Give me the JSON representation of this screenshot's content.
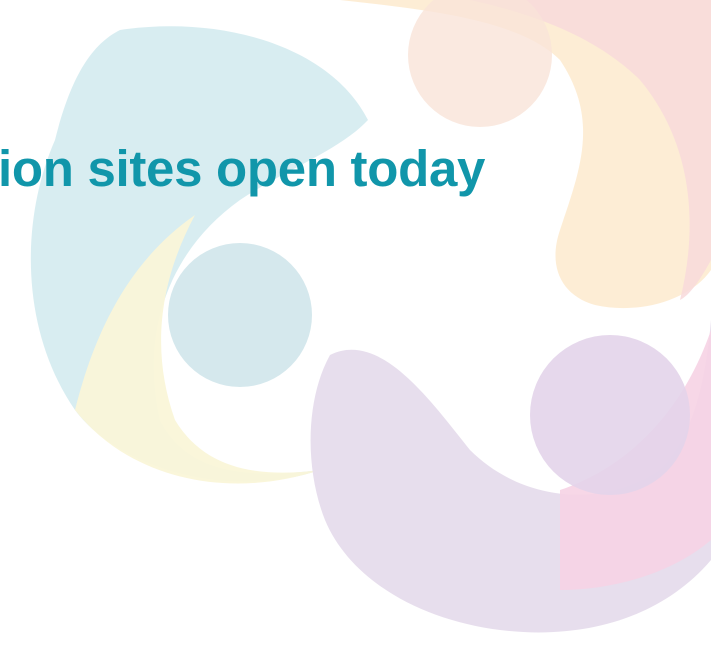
{
  "slide": {
    "headline": "ion sites open today"
  },
  "colors": {
    "background": "#ffffff",
    "headline": "#1196AA",
    "blue_petal": "#D6ECF0",
    "yellow_petal": "#FAF6D8",
    "peach_petal": "#FDEBD0",
    "pink_petal": "#F8D9DA",
    "magenta_petal": "#F6D3E4",
    "lavender_petal": "#E6DCEC"
  },
  "decorations": {
    "artwork": "pastel-pinwheel-logo-icon"
  }
}
